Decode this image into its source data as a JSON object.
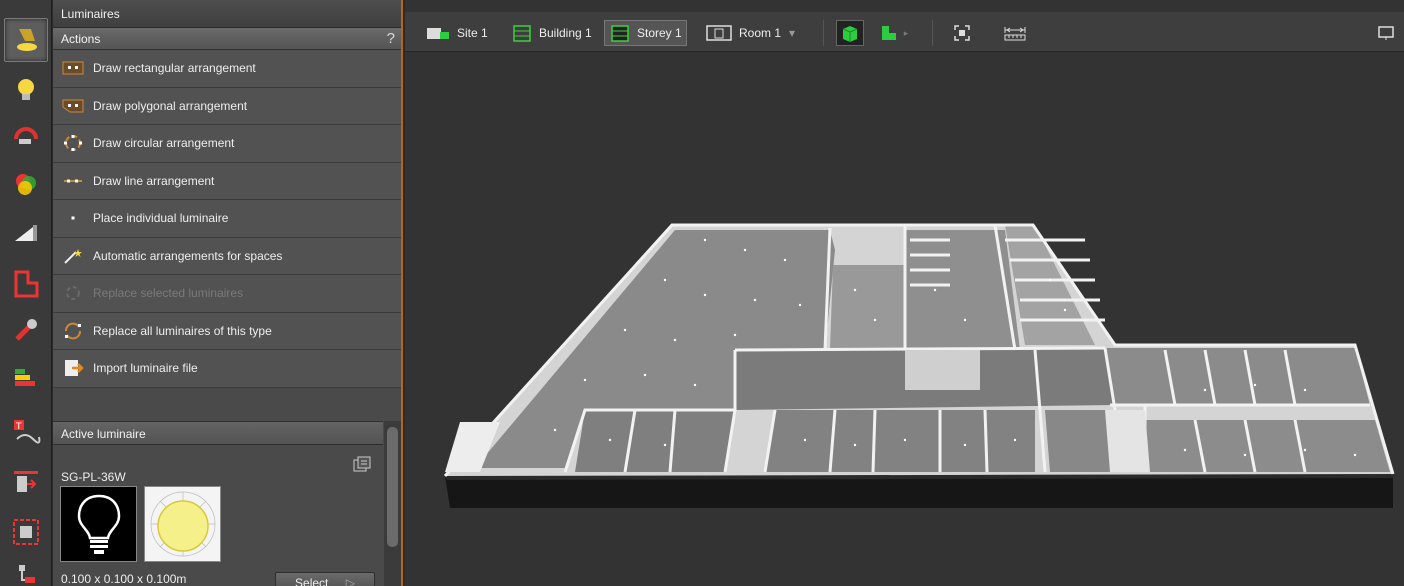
{
  "toolbar": {
    "tools": [
      {
        "name": "luminaires-tool-icon",
        "active": true
      },
      {
        "name": "light-bulb-icon"
      },
      {
        "name": "light-scenes-icon"
      },
      {
        "name": "color-icon"
      },
      {
        "name": "daylight-icon"
      },
      {
        "name": "room-icon"
      },
      {
        "name": "tools-icon"
      },
      {
        "name": "energy-icon"
      },
      {
        "name": "text-label-icon"
      },
      {
        "name": "export-icon"
      },
      {
        "name": "display-icon"
      },
      {
        "name": "hierarchy-icon"
      }
    ]
  },
  "panel": {
    "title": "Luminaires",
    "actions_header": "Actions",
    "help": "?",
    "actions": [
      {
        "label": "Draw rectangular arrangement",
        "icon": "rectangle-arrangement-icon"
      },
      {
        "label": "Draw polygonal arrangement",
        "icon": "polygon-arrangement-icon"
      },
      {
        "label": "Draw circular arrangement",
        "icon": "circular-arrangement-icon"
      },
      {
        "label": "Draw line arrangement",
        "icon": "line-arrangement-icon"
      },
      {
        "label": "Place individual luminaire",
        "icon": "single-luminaire-icon"
      },
      {
        "label": "Automatic arrangements for spaces",
        "icon": "magic-wand-icon"
      },
      {
        "label": "Replace selected luminaires",
        "icon": "replace-selected-icon",
        "disabled": true
      },
      {
        "label": "Replace all luminaires of this type",
        "icon": "replace-all-icon"
      },
      {
        "label": "Import luminaire file",
        "icon": "import-file-icon"
      }
    ],
    "active_luminaire": {
      "header": "Active luminaire",
      "name": "SG-PL-36W",
      "dimensions": "0.100 x 0.100 x 0.100m",
      "select_label": "Select"
    }
  },
  "viewport": {
    "breadcrumbs": [
      {
        "label": "Site 1",
        "icon": "site-icon"
      },
      {
        "label": "Building 1",
        "icon": "building-icon"
      },
      {
        "label": "Storey 1",
        "icon": "storey-icon",
        "active": true
      },
      {
        "label": "Room 1",
        "icon": "room-icon",
        "dropdown": "▾"
      }
    ],
    "colors": {
      "accent_orange": "#b5651d",
      "view_green": "#2ecc40"
    }
  }
}
